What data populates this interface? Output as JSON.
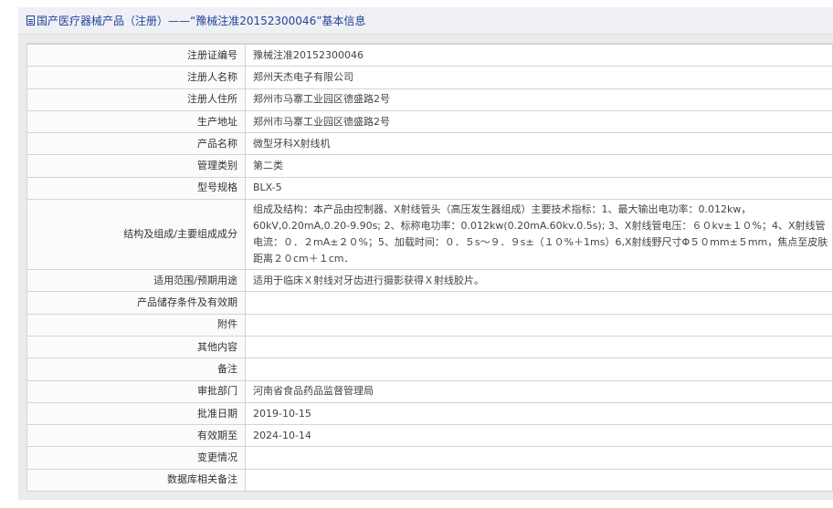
{
  "header": {
    "title": "国产医疗器械产品（注册）——“豫械注准20152300046”基本信息"
  },
  "rows": [
    {
      "label": "注册证编号",
      "value": "豫械注准20152300046"
    },
    {
      "label": "注册人名称",
      "value": "郑州天杰电子有限公司"
    },
    {
      "label": "注册人住所",
      "value": "郑州市马寨工业园区德盛路2号"
    },
    {
      "label": "生产地址",
      "value": "郑州市马寨工业园区德盛路2号"
    },
    {
      "label": "产品名称",
      "value": "微型牙科X射线机"
    },
    {
      "label": "管理类别",
      "value": "第二类"
    },
    {
      "label": "型号规格",
      "value": "BLX-5"
    },
    {
      "label": "结构及组成/主要组成成分",
      "value": "组成及结构：本产品由控制器、X射线管头（高压发生器组成）主要技术指标：1、最大输出电功率：0.012kw，60kV,0.20mA,0.20-9.90s; 2、标称电功率：0.012kw(0.20mA.60kv.0.5s); 3、X射线管电压：６０kv±１０%；4、X射线管电流：０．２mA±２０%；5、加载时间：０．５s～９．９s±（１０%＋1ms）6,X射线野尺寸Φ５０mm±５mm，焦点至皮肤距离２０cm＋１cm．"
    },
    {
      "label": "适用范围/预期用途",
      "value": "适用于临床Ｘ射线对牙齿进行摄影获得Ｘ射线胶片。"
    },
    {
      "label": "产品储存条件及有效期",
      "value": ""
    },
    {
      "label": "附件",
      "value": ""
    },
    {
      "label": "其他内容",
      "value": ""
    },
    {
      "label": "备注",
      "value": ""
    },
    {
      "label": "审批部门",
      "value": "河南省食品药品监督管理局"
    },
    {
      "label": "批准日期",
      "value": "2019-10-15"
    },
    {
      "label": "有效期至",
      "value": "2024-10-14"
    },
    {
      "label": "变更情况",
      "value": ""
    },
    {
      "label": "数据库相关备注",
      "value": ""
    }
  ]
}
